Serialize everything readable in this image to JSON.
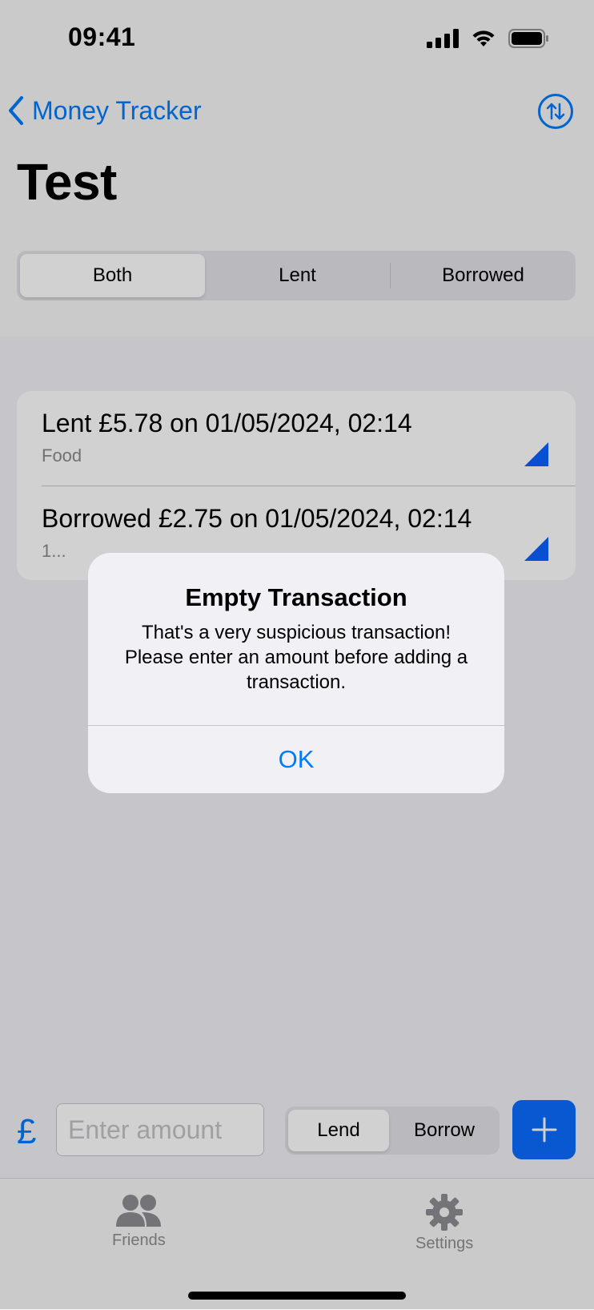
{
  "status_bar": {
    "time": "09:41"
  },
  "nav": {
    "back_label": "Money Tracker",
    "sort_icon": "arrow-up-down-circle-icon"
  },
  "page": {
    "title": "Test"
  },
  "filter": {
    "options": [
      "Both",
      "Lent",
      "Borrowed"
    ],
    "selected": "Both"
  },
  "transactions": [
    {
      "title": "Lent £5.78 on 01/05/2024, 02:14",
      "note": "Food"
    },
    {
      "title": "Borrowed £2.75 on 01/05/2024, 02:14",
      "note": "1..."
    }
  ],
  "input_bar": {
    "currency_symbol": "£",
    "amount_placeholder": "Enter amount",
    "amount_value": "",
    "mode_options": [
      "Lend",
      "Borrow"
    ],
    "mode_selected": "Lend"
  },
  "tabs": [
    {
      "label": "Friends",
      "icon": "people-icon"
    },
    {
      "label": "Settings",
      "icon": "gear-icon"
    }
  ],
  "alert": {
    "title": "Empty Transaction",
    "message": "That's a very suspicious transaction! Please enter an amount before adding a transaction.",
    "button": "OK"
  },
  "colors": {
    "accent": "#007aff",
    "row_marker": "#0a62ff"
  }
}
